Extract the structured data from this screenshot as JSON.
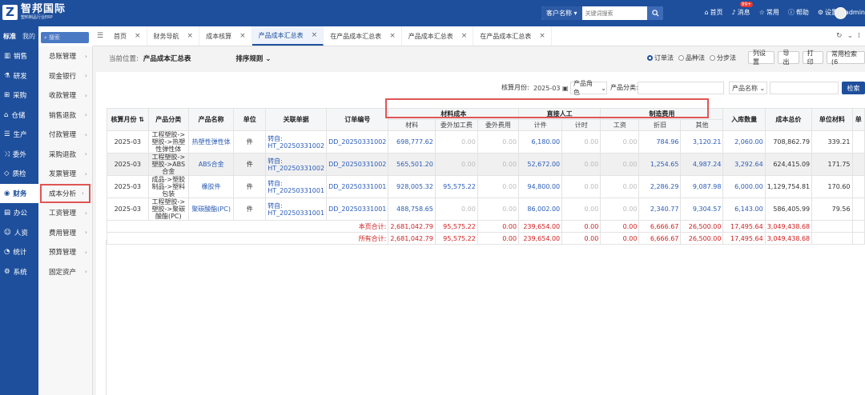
{
  "header": {
    "logo_letter": "Z",
    "title": "智邦国际",
    "subtitle": "塑料制品行业ERP",
    "search_scope": "客户名称",
    "search_placeholder": "关键词搜索",
    "nav": [
      {
        "label": "首页",
        "icon": "home-icon"
      },
      {
        "label": "消息",
        "icon": "bell-icon",
        "badge": "99+"
      },
      {
        "label": "常用",
        "icon": "star-icon"
      },
      {
        "label": "帮助",
        "icon": "help-icon"
      },
      {
        "label": "设置",
        "icon": "gear-icon"
      }
    ],
    "user": "admin"
  },
  "side1": {
    "mode_a": "标准",
    "mode_b": "我的",
    "items": [
      {
        "label": "销售",
        "icon": "chart-icon"
      },
      {
        "label": "研发",
        "icon": "flask-icon"
      },
      {
        "label": "采购",
        "icon": "cart-icon"
      },
      {
        "label": "仓储",
        "icon": "warehouse-icon"
      },
      {
        "label": "生产",
        "icon": "factory-icon"
      },
      {
        "label": "委外",
        "icon": "share-icon"
      },
      {
        "label": "质检",
        "icon": "shield-icon"
      },
      {
        "label": "财务",
        "icon": "coin-icon",
        "active": true
      },
      {
        "label": "办公",
        "icon": "office-icon"
      },
      {
        "label": "人资",
        "icon": "user-icon"
      },
      {
        "label": "统计",
        "icon": "stats-icon"
      },
      {
        "label": "系统",
        "icon": "system-icon"
      }
    ]
  },
  "side2": {
    "search_placeholder": "搜索",
    "items": [
      "总账管理",
      "现金银行",
      "收款管理",
      "销售退款",
      "付款管理",
      "采购退款",
      "发票管理",
      "成本分析",
      "工资管理",
      "费用管理",
      "预算管理",
      "固定资产"
    ],
    "active_index": 7
  },
  "tabs": [
    {
      "label": "首页",
      "active": false
    },
    {
      "label": "财务导航",
      "active": false
    },
    {
      "label": "成本核算",
      "active": false
    },
    {
      "label": "产品成本汇总表",
      "active": true
    },
    {
      "label": "在产品成本汇总表",
      "active": false
    },
    {
      "label": "产品成本汇总表",
      "active": false
    },
    {
      "label": "在产品成本汇总表",
      "active": false
    }
  ],
  "toolbar": {
    "crumb_label": "当前位置:",
    "crumb_page": "产品成本汇总表",
    "sort_label": "排序规则",
    "radios": [
      {
        "label": "订单法",
        "on": true
      },
      {
        "label": "品种法",
        "on": false
      },
      {
        "label": "分步法",
        "on": false
      }
    ],
    "buttons": [
      "列设置",
      "导出",
      "打印",
      "常用检索(6"
    ]
  },
  "filters": {
    "month_label": "核算月份:",
    "month_value": "2025-03",
    "product_role": "产品角色",
    "category_label": "产品分类:",
    "product_name": "产品名称",
    "query_button": "检索"
  },
  "table": {
    "headers": {
      "month": "核算月份",
      "category": "产品分类",
      "name": "产品名称",
      "unit": "单位",
      "doc": "关联单据",
      "order": "订单编号",
      "material_group": "材料成本",
      "labor_group": "直接人工",
      "overhead_group": "制造费用",
      "in_qty": "入库数量",
      "total_cost": "成本总价",
      "unit_material": "单位材料",
      "extra": "单"
    },
    "subheaders": [
      "材料",
      "委外加工费",
      "委外费用",
      "计件",
      "计时",
      "工资",
      "折旧",
      "其他"
    ],
    "rows": [
      {
        "month": "2025-03",
        "category": "工程塑胶->塑胶->热塑性弹性体",
        "name": "热塑性弹性体",
        "unit": "件",
        "doc": "转自: HT_20250331002",
        "order": "DD_20250331002",
        "v": [
          "698,777.62",
          "0.00",
          "0.00",
          "6,180.00",
          "0.00",
          "0.00",
          "784.96",
          "3,120.21",
          "2,060.00",
          "708,862.79",
          "339.21"
        ]
      },
      {
        "month": "2025-03",
        "category": "工程塑胶->塑胶->ABS合金",
        "name": "ABS合金",
        "unit": "件",
        "doc": "转自: HT_20250331002",
        "order": "DD_20250331002",
        "v": [
          "565,501.20",
          "0.00",
          "0.00",
          "52,672.00",
          "0.00",
          "0.00",
          "1,254.65",
          "4,987.24",
          "3,292.64",
          "624,415.09",
          "171.75"
        ]
      },
      {
        "month": "2025-03",
        "category": "成品->塑胶制品->塑料包装",
        "name": "橡胶件",
        "unit": "件",
        "doc": "转自: HT_20250331001",
        "order": "DD_20250331001",
        "v": [
          "928,005.32",
          "95,575.22",
          "0.00",
          "94,800.00",
          "0.00",
          "0.00",
          "2,286.29",
          "9,087.98",
          "6,000.00",
          "1,129,754.81",
          "170.60"
        ]
      },
      {
        "month": "2025-03",
        "category": "工程塑胶->塑胶->聚碳酸酯(PC)",
        "name": "聚碳酸酯(PC)",
        "unit": "件",
        "doc": "转自: HT_20250331001",
        "order": "DD_20250331001",
        "v": [
          "488,758.65",
          "0.00",
          "0.00",
          "86,002.00",
          "0.00",
          "0.00",
          "2,340.77",
          "9,304.57",
          "6,143.00",
          "586,405.99",
          "79.56"
        ]
      }
    ],
    "page_total_label": "本页合计:",
    "page_total": [
      "2,681,042.79",
      "95,575.22",
      "0.00",
      "239,654.00",
      "0.00",
      "0.00",
      "6,666.67",
      "26,500.00",
      "17,495.64",
      "3,049,438.68"
    ],
    "all_total_label": "所有合计:",
    "all_total": [
      "2,681,042.79",
      "95,575.22",
      "0.00",
      "239,654.00",
      "0.00",
      "0.00",
      "6,666.67",
      "26,500.00",
      "17,495.64",
      "3,049,438.68"
    ]
  },
  "colors": {
    "brand": "#1e4f9c",
    "highlight": "#e05555",
    "total": "#d02020"
  }
}
